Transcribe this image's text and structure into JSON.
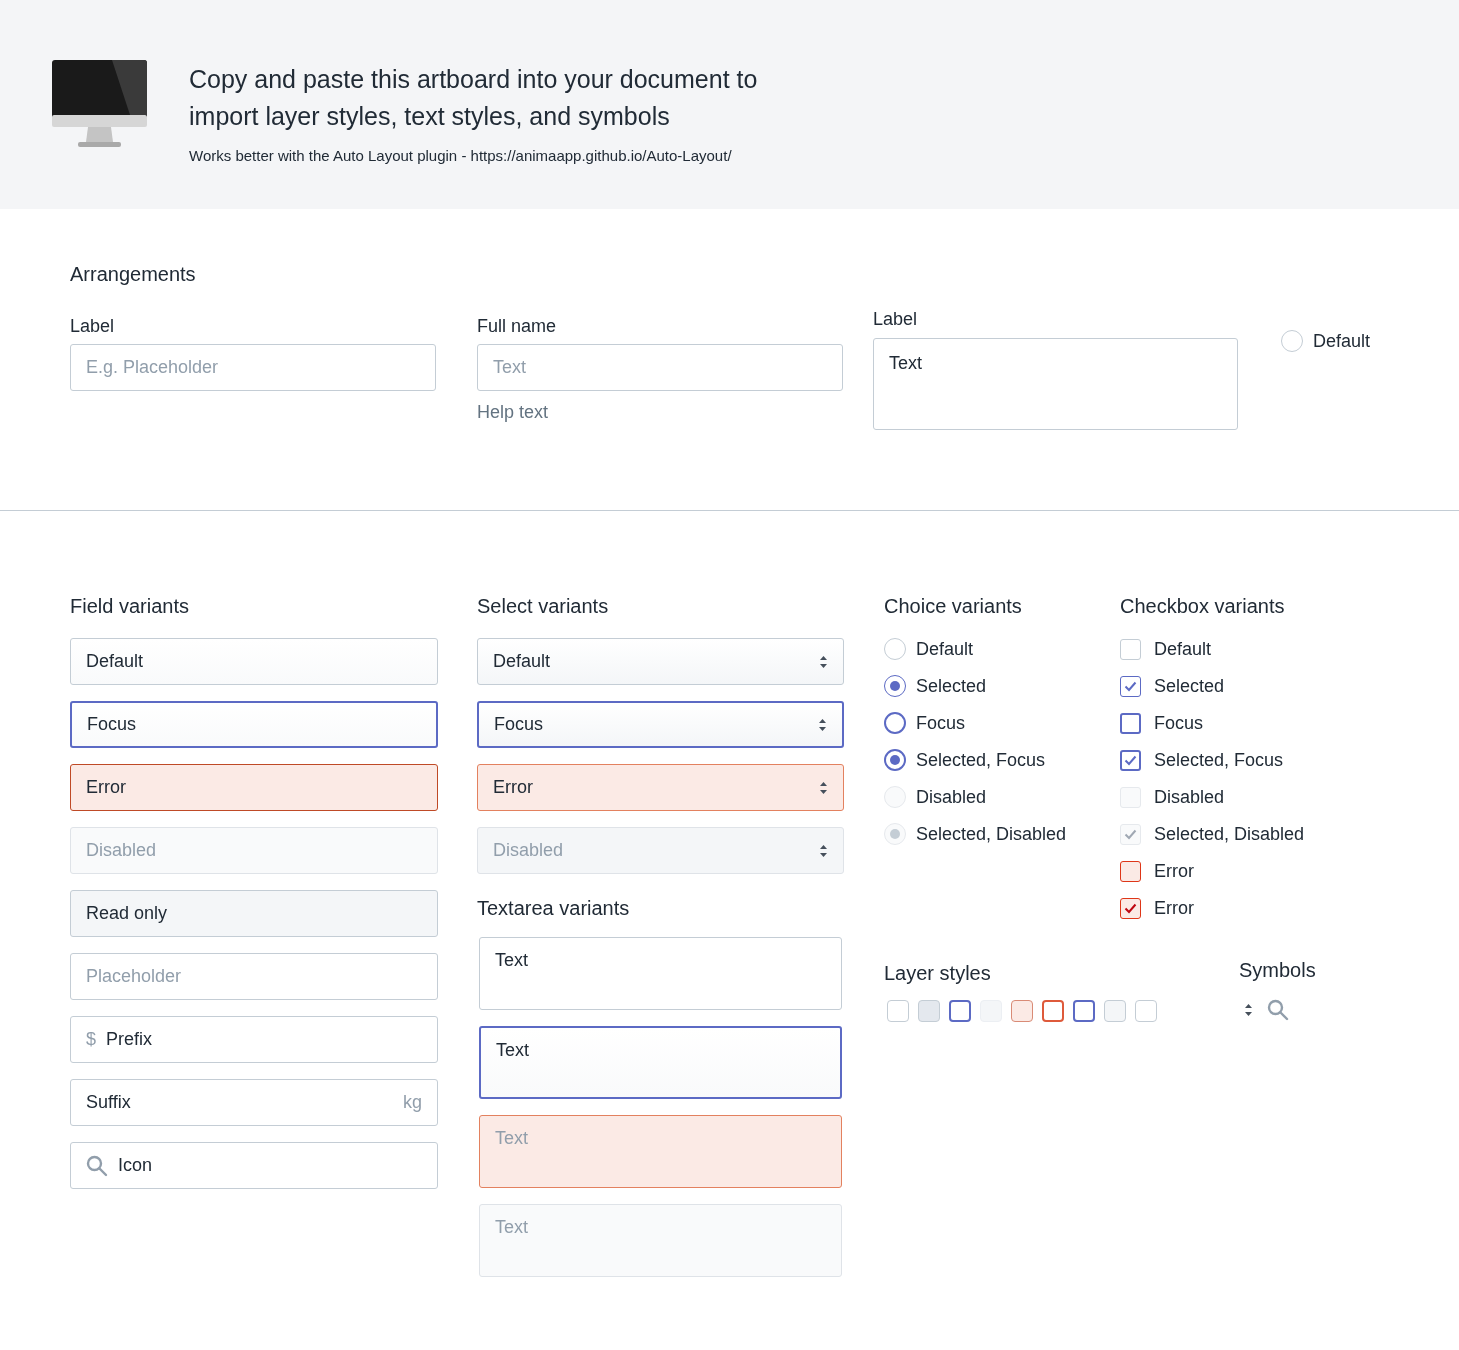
{
  "header": {
    "title": "Copy and paste this artboard into your document to import layer styles, text styles, and symbols",
    "subtitle": "Works better with the Auto Layout plugin - https://animaapp.github.io/Auto-Layout/"
  },
  "arrangements": {
    "title": "Arrangements",
    "field": {
      "label": "Label",
      "placeholder": "E.g. Placeholder"
    },
    "help_field": {
      "label": "Full name",
      "placeholder": "Text",
      "help": "Help text"
    },
    "textarea": {
      "label": "Label",
      "value": "Text"
    },
    "radio": {
      "label": "Default",
      "selected": false
    }
  },
  "field_variants": {
    "title": "Field variants",
    "items": [
      {
        "kind": "default",
        "value": "Default"
      },
      {
        "kind": "focus",
        "value": "Focus"
      },
      {
        "kind": "error",
        "value": "Error"
      },
      {
        "kind": "disabled",
        "value": "Disabled"
      },
      {
        "kind": "readonly",
        "value": "Read only"
      },
      {
        "kind": "placeholder",
        "placeholder": "Placeholder"
      },
      {
        "kind": "prefix",
        "prefix": "$",
        "value": "Prefix"
      },
      {
        "kind": "suffix",
        "value": "Suffix",
        "suffix": "kg"
      },
      {
        "kind": "icon",
        "value": "Icon"
      }
    ]
  },
  "select_variants": {
    "title": "Select variants",
    "items": [
      {
        "kind": "default",
        "value": "Default"
      },
      {
        "kind": "focus",
        "value": "Focus"
      },
      {
        "kind": "error",
        "value": "Error"
      },
      {
        "kind": "disabled",
        "value": "Disabled"
      }
    ]
  },
  "textarea_variants": {
    "title": "Textarea variants",
    "items": [
      {
        "kind": "default",
        "value": "Text"
      },
      {
        "kind": "focus",
        "value": "Text"
      },
      {
        "kind": "error",
        "placeholder": "Text"
      },
      {
        "kind": "disabled",
        "placeholder": "Text"
      }
    ]
  },
  "choice_variants": {
    "title": "Choice variants",
    "items": [
      {
        "label": "Default",
        "selected": false,
        "kind": "default"
      },
      {
        "label": "Selected",
        "selected": true,
        "kind": "default"
      },
      {
        "label": "Focus",
        "selected": false,
        "kind": "focus"
      },
      {
        "label": "Selected, Focus",
        "selected": true,
        "kind": "focus"
      },
      {
        "label": "Disabled",
        "selected": false,
        "kind": "disabled"
      },
      {
        "label": "Selected, Disabled",
        "selected": true,
        "kind": "disabled"
      }
    ]
  },
  "checkbox_variants": {
    "title": "Checkbox variants",
    "items": [
      {
        "label": "Default",
        "checked": false,
        "kind": "default"
      },
      {
        "label": "Selected",
        "checked": true,
        "kind": "default"
      },
      {
        "label": "Focus",
        "checked": false,
        "kind": "focus"
      },
      {
        "label": "Selected, Focus",
        "checked": true,
        "kind": "focus"
      },
      {
        "label": "Disabled",
        "checked": false,
        "kind": "disabled"
      },
      {
        "label": "Selected, Disabled",
        "checked": true,
        "kind": "disabled"
      },
      {
        "label": "Error",
        "checked": false,
        "kind": "error"
      },
      {
        "label": "Error",
        "checked": true,
        "kind": "error"
      }
    ]
  },
  "layer_styles": {
    "title": "Layer styles",
    "swatches": [
      {
        "kind": "default"
      },
      {
        "kind": "pressed"
      },
      {
        "kind": "focus"
      },
      {
        "kind": "disabled"
      },
      {
        "kind": "error-fill"
      },
      {
        "kind": "error"
      },
      {
        "kind": "focus"
      },
      {
        "kind": "subtle"
      },
      {
        "kind": "default"
      }
    ]
  },
  "symbols": {
    "title": "Symbols"
  }
}
